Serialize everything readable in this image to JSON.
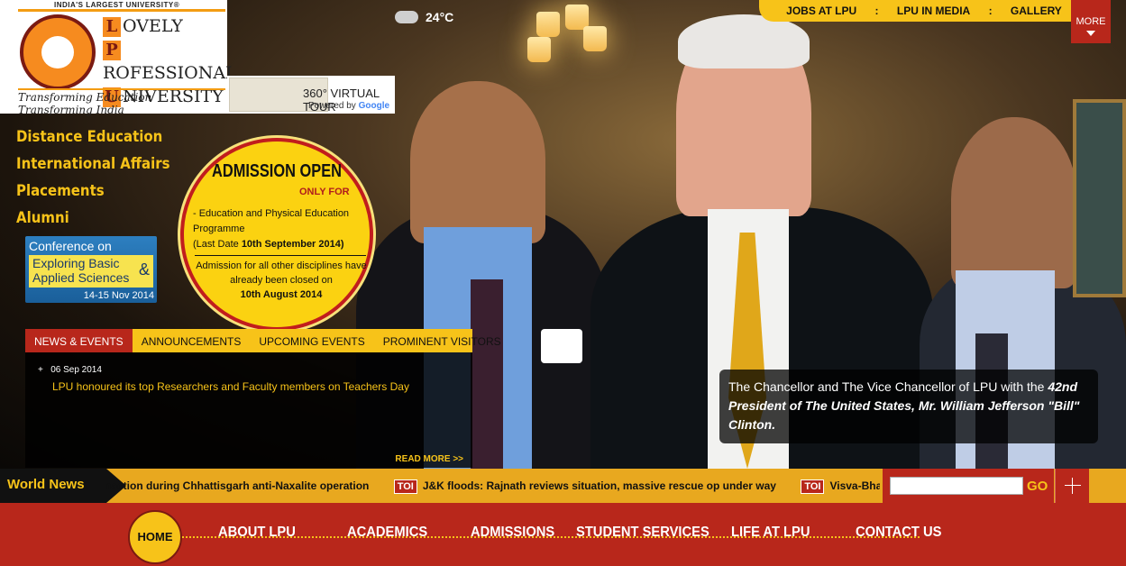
{
  "header": {
    "tagline_top": "INDIA'S LARGEST UNIVERSITY®",
    "logo_words": [
      "OVELY",
      "ROFESSIONAL",
      "NIVERSITY"
    ],
    "logo_initials": [
      "L",
      "P",
      "U"
    ],
    "motto": "Transforming Education Transforming India",
    "tour_label": "360° VIRTUAL TOUR",
    "tour_powered": "Powered by",
    "tour_powered_brand": "Google",
    "temperature": "24°C"
  },
  "top_nav": {
    "items": [
      "JOBS AT LPU",
      "LPU IN MEDIA",
      "GALLERY"
    ],
    "more_label": "MORE"
  },
  "left_links": [
    "Distance Education",
    "International Affairs",
    "Placements",
    "Alumni"
  ],
  "conference": {
    "title": "Conference on",
    "line1": "Exploring Basic",
    "line2": "Applied Sciences",
    "amp": "&",
    "dates": "14-15 Nov 2014"
  },
  "admission": {
    "title": "ADMISSION OPEN",
    "only_for": "ONLY FOR",
    "programme": "- Education and Physical Education Programme",
    "last_date_prefix": "(Last Date",
    "last_date": "10th September 2014)",
    "other": "Admission for all other disciplines have already been closed on",
    "closed_date": "10th August 2014"
  },
  "news": {
    "tabs": [
      "NEWS & EVENTS",
      "ANNOUNCEMENTS",
      "UPCOMING EVENTS",
      "PROMINENT VISITORS"
    ],
    "date": "06 Sep 2014",
    "headline": "LPU honoured its top Researchers and Faculty members on Teachers Day",
    "read_more": "READ MORE >>"
  },
  "caption": {
    "text_plain": "The Chancellor and The Vice Chancellor of LPU with the",
    "text_italic": "42nd President of The United States, Mr. William Jefferson \"Bill\" Clinton."
  },
  "ticker": {
    "label": "World News",
    "items": [
      {
        "source": "",
        "text": "naction during Chhattisgarh anti-Naxalite operation"
      },
      {
        "source": "TOI",
        "text": "J&K floods: Rajnath reviews situation, massive rescue op under way"
      },
      {
        "source": "TOI",
        "text": "Visva-Bhara"
      }
    ],
    "go_label": "GO"
  },
  "main_nav": {
    "home": "HOME",
    "items": [
      "ABOUT LPU",
      "ACADEMICS",
      "ADMISSIONS",
      "STUDENT SERVICES",
      "LIFE AT LPU",
      "CONTACT US"
    ]
  }
}
